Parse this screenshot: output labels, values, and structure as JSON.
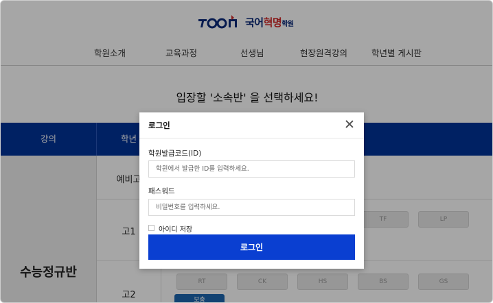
{
  "header": {
    "logo_text_main": "국어",
    "logo_text_red": "혁명",
    "logo_text_small": "학원"
  },
  "nav": {
    "items": [
      "학원소개",
      "교육과정",
      "선생님",
      "현장원격강의",
      "학년별 게시판"
    ]
  },
  "heading": "입장할 '소속반' 을 선택하세요!",
  "table": {
    "col_lecture": "강의",
    "col_grade": "학년",
    "course_name": "수능정규반",
    "grades": [
      "예비고",
      "고1",
      "고2"
    ],
    "row_go1_buttons": [
      "TF",
      "LP"
    ],
    "row_go2_buttons": [
      "RT",
      "CK",
      "HS",
      "BS",
      "GS"
    ],
    "extra_tab": "보충"
  },
  "modal": {
    "title": "로그인",
    "id_label": "학원발급코드(ID)",
    "id_placeholder": "학원에서 발급한 ID를 입력하세요.",
    "pw_label": "패스워드",
    "pw_placeholder": "비밀번호를 입력하세요.",
    "remember_label": "아이디 저장",
    "submit_label": "로그인"
  },
  "colors": {
    "primary_blue": "#003399",
    "login_button": "#0a3fd1",
    "logo_red": "#d12a2a"
  }
}
